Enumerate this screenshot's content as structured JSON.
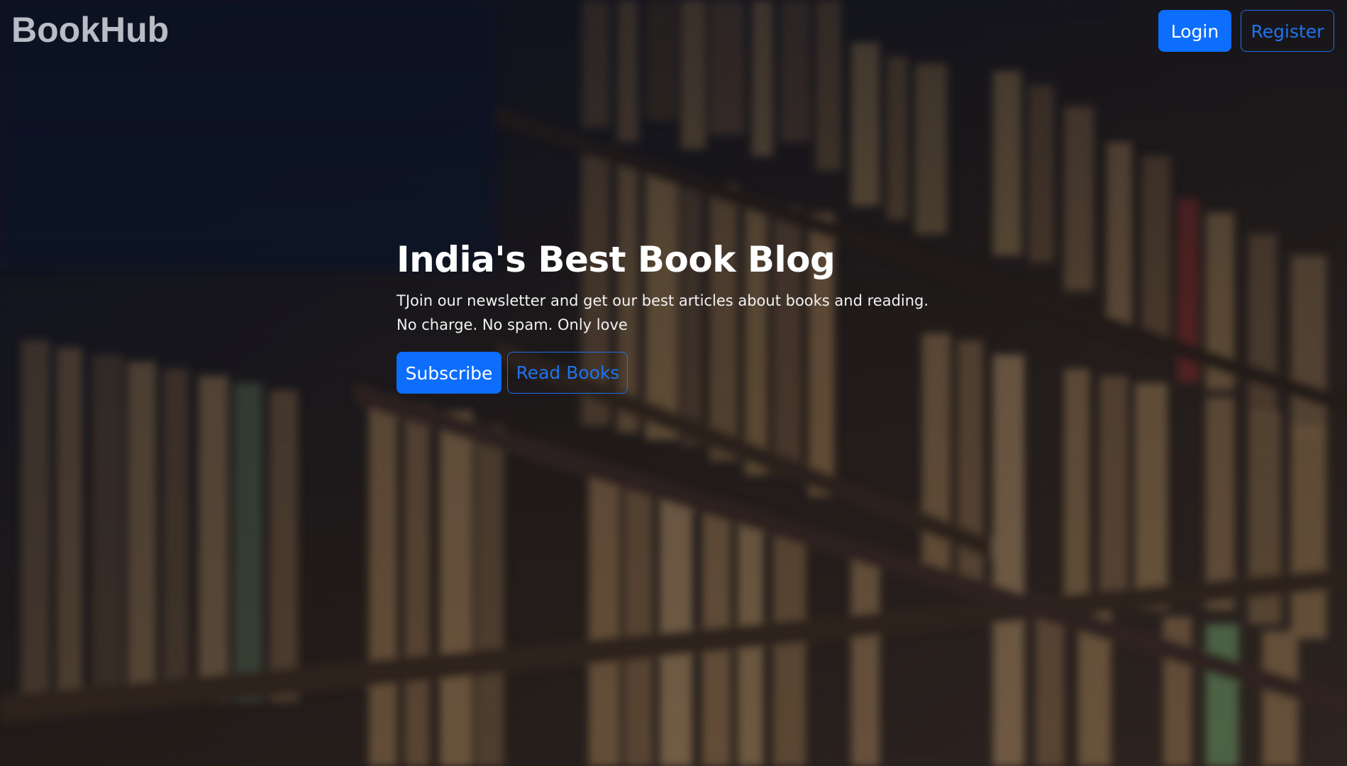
{
  "navbar": {
    "brand": "BookHub",
    "login_label": "Login",
    "register_label": "Register"
  },
  "hero": {
    "background": "bookshelf-photo",
    "title": "India's Best Book Blog",
    "description": "TJoin our newsletter and get our best articles about books and reading. No charge. No spam. Only love",
    "subscribe_label": "Subscribe",
    "read_books_label": "Read Books"
  },
  "colors": {
    "primary": "#0d6efd",
    "brand_text": "#b8bcc4",
    "heading_text": "#ffffff"
  }
}
